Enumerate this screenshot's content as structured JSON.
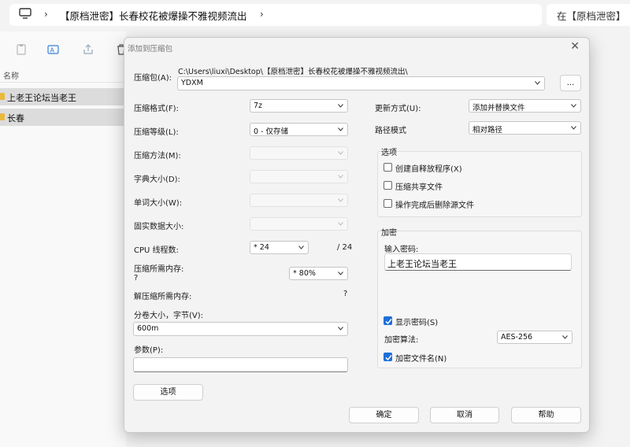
{
  "explorer": {
    "address_path": "【原档泄密】长春校花被爆操不雅视频流出",
    "search_placeholder": "在【原档泄密】",
    "column_name": "名称",
    "folders": [
      "上老王论坛当老王",
      "长春"
    ]
  },
  "dialog": {
    "title": "添加到压缩包",
    "archive_label": "压缩包(A):",
    "archive_path": "C:\\Users\\liuxi\\Desktop\\【原档泄密】长春校花被爆操不雅视频流出\\",
    "archive_name": "YDXM",
    "browse_label": "...",
    "format_label": "压缩格式(F):",
    "format_value": "7z",
    "level_label": "压缩等级(L):",
    "level_value": "0 - 仅存储",
    "method_label": "压缩方法(M):",
    "dict_label": "字典大小(D):",
    "word_label": "单词大小(W):",
    "solid_label": "固实数据大小:",
    "threads_label": "CPU 线程数:",
    "threads_value": "* 24",
    "threads_max": "/ 24",
    "mem_comp_label": "压缩所需内存:",
    "mem_comp_q": "?",
    "mem_comp_value": "* 80%",
    "mem_decomp_label": "解压缩所需内存:",
    "mem_decomp_q": "?",
    "volume_label": "分卷大小，字节(V):",
    "volume_value": "600m",
    "params_label": "参数(P):",
    "params_value": "",
    "options_button": "选项",
    "update_label": "更新方式(U):",
    "update_value": "添加并替换文件",
    "pathmode_label": "路径模式",
    "pathmode_value": "相对路径",
    "options_group": {
      "title": "选项",
      "sfx": "创建自释放程序(X)",
      "shared": "压缩共享文件",
      "delete_after": "操作完成后删除源文件"
    },
    "encryption": {
      "title": "加密",
      "password_label": "输入密码:",
      "password_value": "上老王论坛当老王",
      "show_password": "显示密码(S)",
      "method_label": "加密算法:",
      "method_value": "AES-256",
      "encrypt_names": "加密文件名(N)"
    },
    "ok_button": "确定",
    "cancel_button": "取消",
    "help_button": "帮助"
  },
  "colors": {
    "accent": "#1e6fd9",
    "folder": "#e9b93a"
  }
}
